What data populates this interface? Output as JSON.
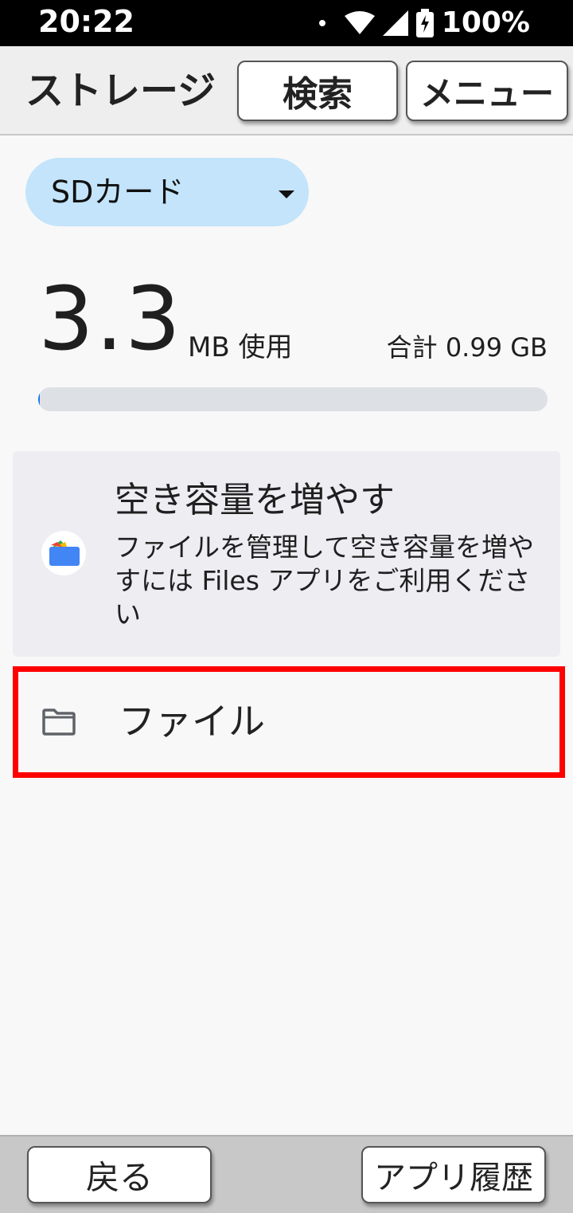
{
  "status_bar": {
    "time": "20:22",
    "battery_text": "100%",
    "icons": [
      "notification-dot-icon",
      "wifi-icon",
      "signal-icon",
      "battery-charging-icon"
    ]
  },
  "app_bar": {
    "title": "ストレージ",
    "search_label": "検索",
    "menu_label": "メニュー"
  },
  "storage_selector": {
    "selected": "SDカード",
    "icon": "dropdown-arrow-icon"
  },
  "usage": {
    "used_value": "3.3",
    "used_unit": "MB 使用",
    "total": "合計 0.99 GB",
    "used_fraction": 0.0033
  },
  "promo": {
    "title": "空き容量を増やす",
    "description": "ファイルを管理して空き容量を増やすには Files アプリをご利用ください",
    "icon": "files-app-icon"
  },
  "list": {
    "files_label": "ファイル",
    "files_icon": "folder-icon"
  },
  "bottom_bar": {
    "back_label": "戻る",
    "history_label": "アプリ履歴"
  },
  "colors": {
    "chip_background": "#c3e4fb",
    "progress_track": "#dde1e6",
    "highlight_border": "#ff0000"
  }
}
